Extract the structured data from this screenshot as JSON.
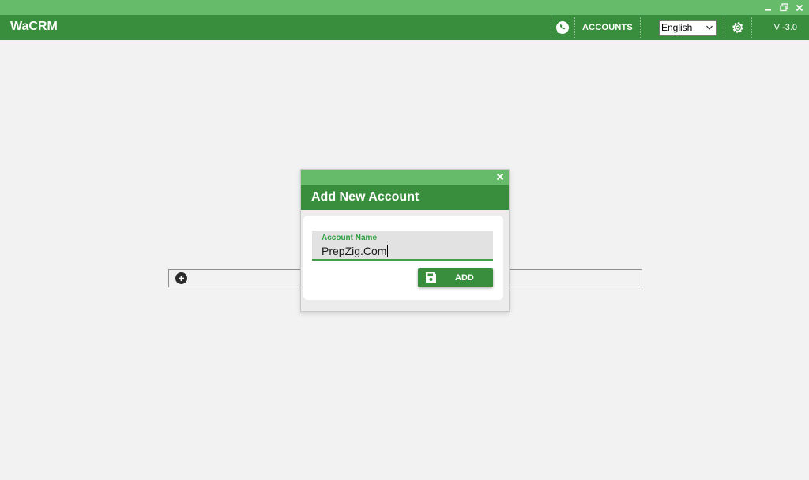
{
  "app": {
    "title": "WaCRM",
    "version": "V -3.0"
  },
  "nav": {
    "accounts_label": "ACCOUNTS",
    "language": "English"
  },
  "dialog": {
    "title": "Add New Account",
    "field_label": "Account Name",
    "field_value": "PrepZig.Com",
    "add_label": "ADD"
  },
  "colors": {
    "primary_dark": "#388e3c",
    "primary_light": "#66bb6a",
    "background": "#f2f2f2"
  },
  "icons": [
    "minimize-icon",
    "restore-icon",
    "close-icon",
    "whatsapp-icon",
    "chevron-down-icon",
    "gear-icon",
    "plus-circle-icon",
    "save-icon"
  ]
}
